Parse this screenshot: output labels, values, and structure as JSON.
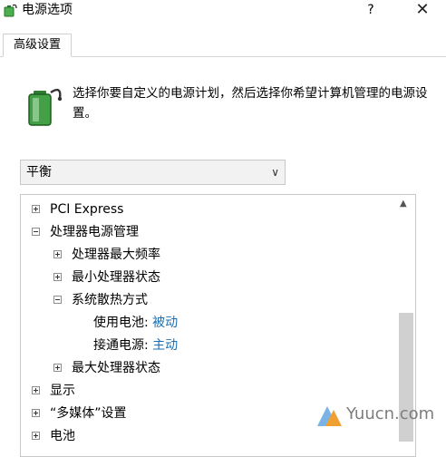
{
  "window": {
    "title": "电源选项",
    "help": "?",
    "close": "✕"
  },
  "tabs": [
    {
      "label": "高级设置"
    }
  ],
  "description": "选择你要自定义的电源计划，然后选择你希望计算机管理的电源设置。",
  "plan": {
    "selected": "平衡",
    "chevron": "∨"
  },
  "tree": {
    "pci_express": "PCI Express",
    "cpu_power": "处理器电源管理",
    "cpu_max_freq": "处理器最大频率",
    "cpu_min_state": "最小处理器状态",
    "cooling_policy": "系统散热方式",
    "on_battery_label": "使用电池:",
    "on_battery_value": "被动",
    "plugged_in_label": "接通电源:",
    "plugged_in_value": "主动",
    "cpu_max_state": "最大处理器状态",
    "display": "显示",
    "multimedia": "“多媒体”设置",
    "battery": "电池"
  },
  "scrollbar": {
    "up_arrow": "▲",
    "position": 0.48
  },
  "watermark": {
    "text": "Yuucn.com"
  },
  "colors": {
    "link": "#1a6fb5",
    "battery_green": "#3aa040"
  },
  "icons": {
    "app": "battery-power-icon",
    "settings": "battery-settings-icon"
  }
}
